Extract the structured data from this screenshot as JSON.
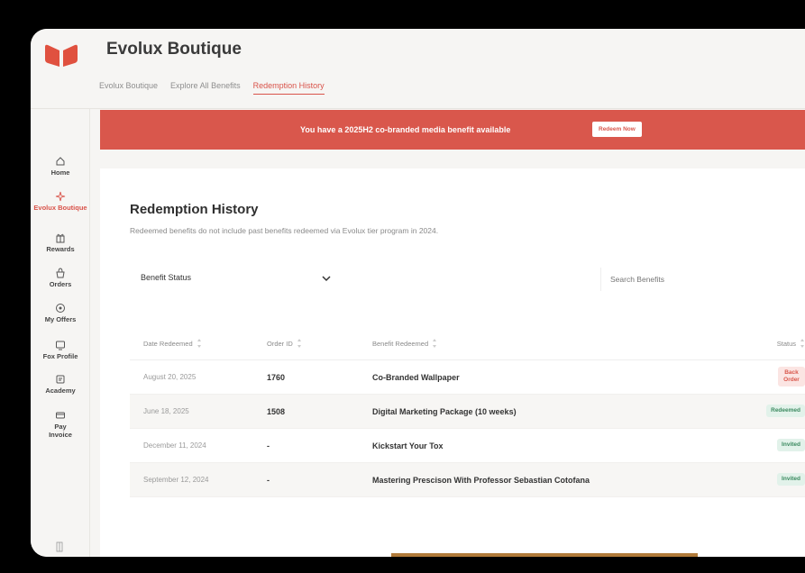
{
  "header": {
    "title": "Evolux Boutique",
    "breadcrumb": [
      "Evolux Boutique",
      "Explore All Benefits",
      "Redemption History"
    ]
  },
  "sidebar": {
    "items": [
      {
        "label": "Home",
        "icon": "home-icon"
      },
      {
        "label": "Evolux Boutique",
        "icon": "sparkle-icon",
        "active": true
      },
      {
        "label": "Rewards",
        "icon": "gift-icon"
      },
      {
        "label": "Orders",
        "icon": "bag-icon"
      },
      {
        "label": "My Offers",
        "icon": "offer-icon"
      },
      {
        "label": "Fox Profile",
        "icon": "profile-icon"
      },
      {
        "label": "Academy",
        "icon": "book-icon"
      },
      {
        "label": "Pay Invoice",
        "icon": "card-icon"
      }
    ]
  },
  "banner": {
    "text": "You have a 2025H2 co-branded media benefit available",
    "button": "Redeem Now"
  },
  "main": {
    "title": "Redemption History",
    "subtitle": "Redeemed benefits do not include past benefits redeemed via Evolux tier program in 2024.",
    "filter_label": "Benefit Status",
    "search_placeholder": "Search Benefits"
  },
  "table": {
    "columns": [
      "Date Redeemed",
      "Order ID",
      "Benefit Redeemed",
      "Status"
    ],
    "rows": [
      {
        "date": "August 20, 2025",
        "order_id": "1760",
        "benefit": "Co-Branded Wallpaper",
        "status": "Back Order",
        "status_type": "backorder"
      },
      {
        "date": "June 18, 2025",
        "order_id": "1508",
        "benefit": "Digital Marketing Package (10 weeks)",
        "status": "Redeemed",
        "status_type": "redeemed"
      },
      {
        "date": "December 11, 2024",
        "order_id": "-",
        "benefit": "Kickstart Your Tox",
        "status": "Invited",
        "status_type": "invited"
      },
      {
        "date": "September 12, 2024",
        "order_id": "-",
        "benefit": "Mastering Prescison With Professor Sebastian Cotofana",
        "status": "Invited",
        "status_type": "invited"
      }
    ]
  },
  "colors": {
    "accent": "#d9574c",
    "background": "#f6f5f3",
    "success": "#3c8a60"
  }
}
